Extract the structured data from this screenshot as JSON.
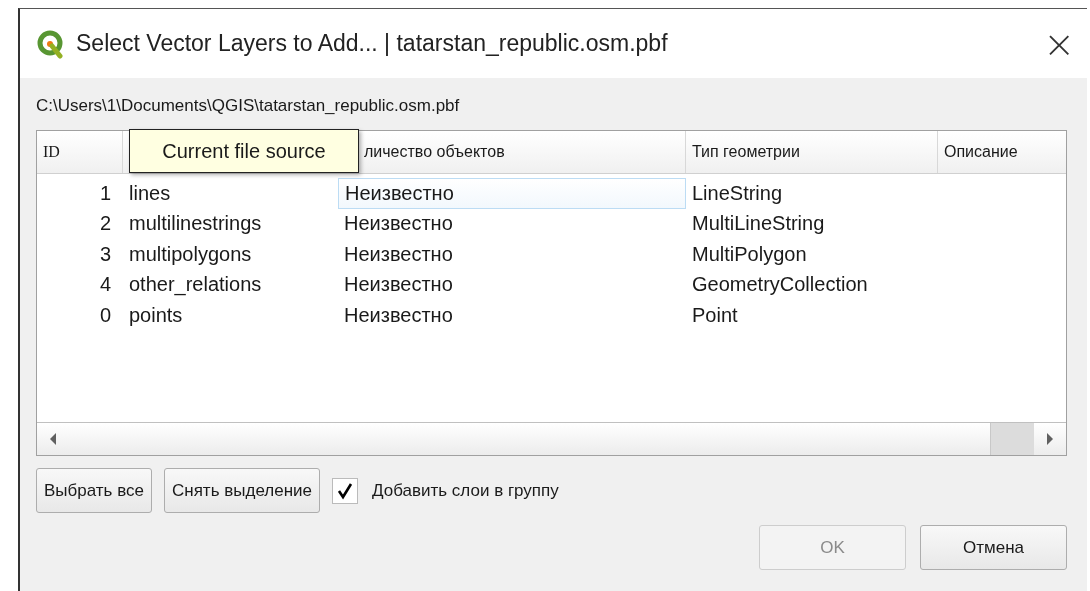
{
  "window": {
    "title": "Select Vector Layers to Add... | tatarstan_republic.osm.pbf",
    "close": "×"
  },
  "path": "C:\\Users\\1\\Documents\\QGIS\\tatarstan_republic.osm.pbf",
  "table": {
    "columns": [
      {
        "label": "ID"
      },
      {},
      {
        "label": "личество объектов"
      },
      {
        "label": "Тип геометрии"
      },
      {
        "label": "Описание"
      }
    ],
    "rows": [
      {
        "id": "1",
        "name": "lines",
        "count": "Неизвестно",
        "geometry": "LineString",
        "focused": true
      },
      {
        "id": "2",
        "name": "multilinestrings",
        "count": "Неизвестно",
        "geometry": "MultiLineString",
        "focused": false
      },
      {
        "id": "3",
        "name": "multipolygons",
        "count": "Неизвестно",
        "geometry": "MultiPolygon",
        "focused": false
      },
      {
        "id": "4",
        "name": "other_relations",
        "count": "Неизвестно",
        "geometry": "GeometryCollection",
        "focused": false
      },
      {
        "id": "0",
        "name": "points",
        "count": "Неизвестно",
        "geometry": "Point",
        "focused": false
      }
    ]
  },
  "tooltip": "Current file source",
  "buttons": [
    {
      "label": "Выбрать все"
    },
    {
      "label": "Снять выделение"
    }
  ],
  "add_to_group": {
    "label": "Добавить слои в группу",
    "checked": true
  },
  "dialog_buttons": [
    {
      "label": "OK",
      "disabled": true
    },
    {
      "label": "Отмена",
      "disabled": false
    }
  ]
}
